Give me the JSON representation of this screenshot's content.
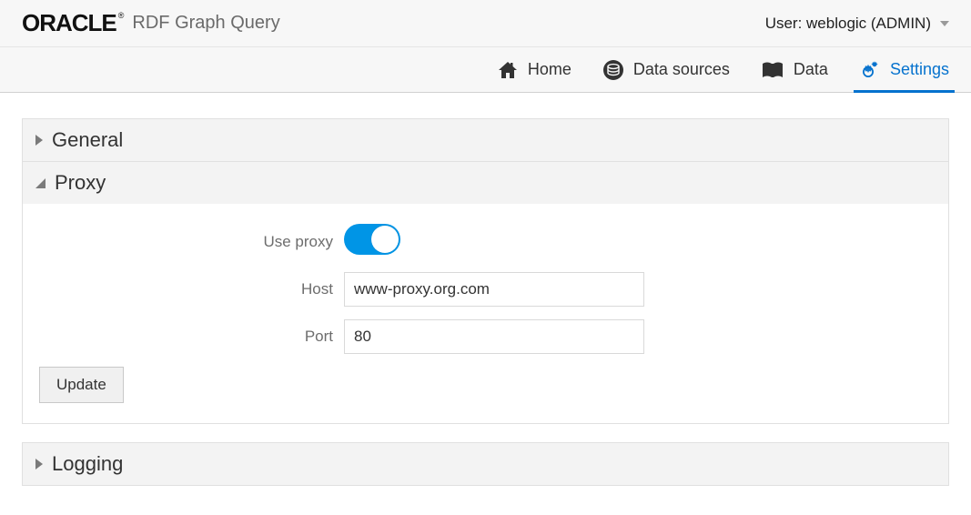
{
  "header": {
    "brand": "ORACLE",
    "brand_reg": "®",
    "app_title": "RDF Graph Query",
    "user_label": "User: weblogic (ADMIN)"
  },
  "nav": {
    "home": "Home",
    "data_sources": "Data sources",
    "data": "Data",
    "settings": "Settings"
  },
  "panels": {
    "general": {
      "title": "General"
    },
    "proxy": {
      "title": "Proxy",
      "use_proxy_label": "Use proxy",
      "use_proxy_on": true,
      "host_label": "Host",
      "host_value": "www-proxy.org.com",
      "port_label": "Port",
      "port_value": "80",
      "update_label": "Update"
    },
    "logging": {
      "title": "Logging"
    }
  },
  "colors": {
    "accent": "#0572ce",
    "toggle": "#0095e6"
  }
}
